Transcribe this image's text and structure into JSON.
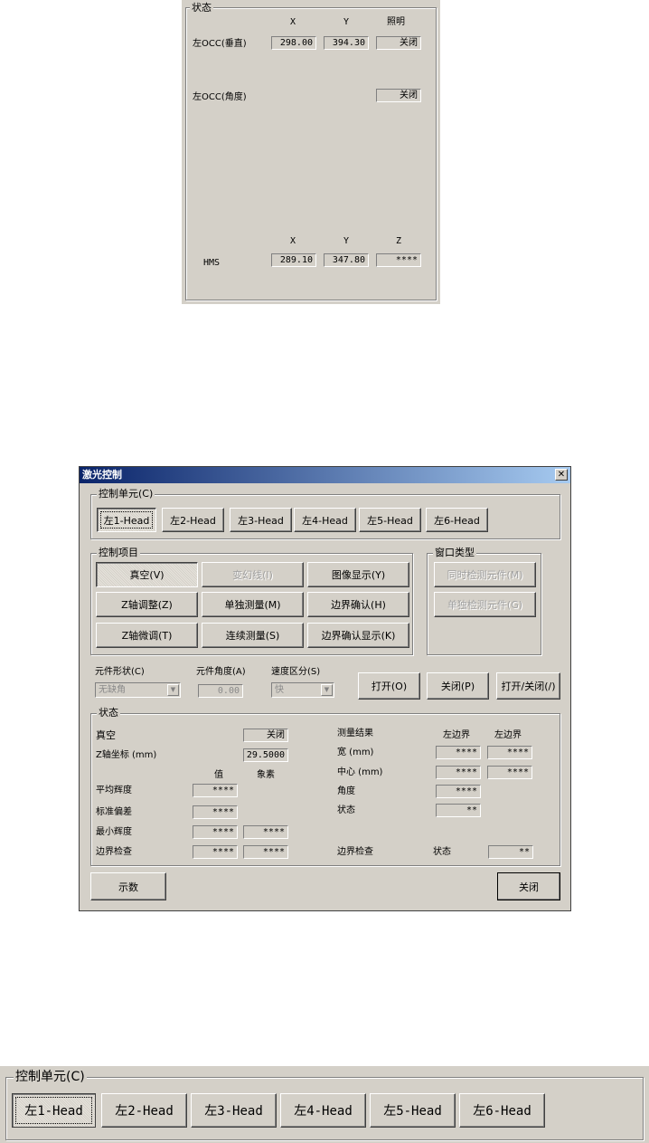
{
  "status_panel": {
    "legend": "状态",
    "col_x": "X",
    "col_y": "Y",
    "col_light": "照明",
    "row1": {
      "label": "左OCC(垂直)",
      "x": "298.00",
      "y": "394.30",
      "light": "关闭"
    },
    "row2": {
      "label": "左OCC(角度)",
      "light": "关闭"
    },
    "hms_header": {
      "x": "X",
      "y": "Y",
      "z": "Z"
    },
    "hms": {
      "label": "HMS",
      "x": "289.10",
      "y": "347.80",
      "z": "****"
    }
  },
  "dialog": {
    "title": "激光控制",
    "close_icon": "✕",
    "control_unit": {
      "legend": "控制单元(C)",
      "heads": [
        "左1-Head",
        "左2-Head",
        "左3-Head",
        "左4-Head",
        "左5-Head",
        "左6-Head"
      ]
    },
    "control_items": {
      "legend": "控制项目",
      "buttons": [
        "真空(V)",
        "变幻线(I)",
        "图像显示(Y)",
        "Z轴调整(Z)",
        "单独测量(M)",
        "边界确认(H)",
        "Z轴微调(T)",
        "连续测量(S)",
        "边界确认显示(K)"
      ]
    },
    "window_type": {
      "legend": "窗口类型",
      "buttons": [
        "同时检测元件(M)",
        "单独检测元件(G)"
      ]
    },
    "shape": {
      "label": "元件形状(C)",
      "value": "无缺角"
    },
    "angle": {
      "label": "元件角度(A)",
      "value": "0.00"
    },
    "speed": {
      "label": "速度区分(S)",
      "value": "快"
    },
    "open_button": "打开(O)",
    "close_button": "关闭(P)",
    "toggle_button": "打开/关闭(/)",
    "status": {
      "legend": "状态",
      "vacuum_label": "真空",
      "vacuum_value": "关闭",
      "z_label": "Z轴坐标 (mm)",
      "z_value": "29.5000",
      "col_value": "值",
      "col_pixel": "象素",
      "avg_label": "平均辉度",
      "avg_value": "****",
      "std_label": "标准偏差",
      "std_value": "****",
      "min_label": "最小辉度",
      "min_value": "****",
      "min_pixel": "****",
      "edge_label": "边界检查",
      "edge_value": "****",
      "edge_pixel": "****",
      "result_label": "测量结果",
      "left_edge_1": "左边界",
      "left_edge_2": "左边界",
      "width_label": "宽 (mm)",
      "width_v1": "****",
      "width_v2": "****",
      "center_label": "中心 (mm)",
      "center_v1": "****",
      "center_v2": "****",
      "angle_label": "角度",
      "angle_value": "****",
      "state_label": "状态",
      "state_value": "**",
      "edge_check_label": "边界检查",
      "edge_state_label": "状态",
      "edge_state_value": "**"
    },
    "show_button": "示数",
    "bottom_close_button": "关闭"
  },
  "zoom_unit": {
    "legend": "控制单元(C)",
    "heads": [
      "左1-Head",
      "左2-Head",
      "左3-Head",
      "左4-Head",
      "左5-Head",
      "左6-Head"
    ]
  }
}
